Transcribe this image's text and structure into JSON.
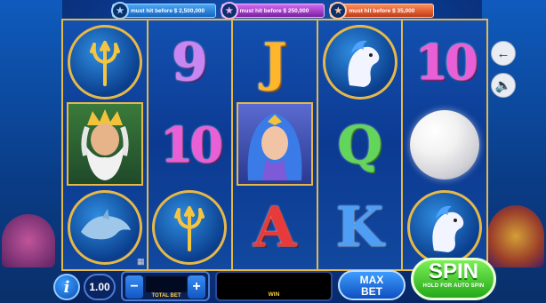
{
  "jackpots": [
    {
      "label": "must hit before $ 2,500,000",
      "icon": "blue-star-badge",
      "color": "#1565c0"
    },
    {
      "label": "must hit before $ 250,000",
      "icon": "pink-star-badge",
      "color": "#7b1fa2"
    },
    {
      "label": "must hit before $ 35,000",
      "icon": "orange-star-badge",
      "color": "#c23b16"
    }
  ],
  "reels": [
    [
      "trident",
      "poseidon",
      "dolphin"
    ],
    [
      "9",
      "10",
      "trident"
    ],
    [
      "J",
      "mermaid",
      "A"
    ],
    [
      "seahorse",
      "Q",
      "K"
    ],
    [
      "10",
      "pearl",
      "seahorse"
    ]
  ],
  "controls": {
    "info_label": "i",
    "coin_value": "1.00",
    "bet_minus": "−",
    "bet_plus": "+",
    "bet_value": "",
    "total_bet_label": "TOTAL BET",
    "win_value": "",
    "win_label": "WIN",
    "max_bet_line1": "MAX",
    "max_bet_line2": "BET",
    "spin_label": "SPIN",
    "spin_sub": "HOLD FOR AUTO SPIN"
  },
  "side": {
    "back_icon": "back-arrow-icon",
    "sound_icon": "speaker-icon"
  },
  "colors": {
    "frame_gold": "#e5b84a",
    "reel_blue": "#1350b0",
    "spin_green": "#25a81a",
    "max_bet_blue": "#0f4fc0"
  }
}
